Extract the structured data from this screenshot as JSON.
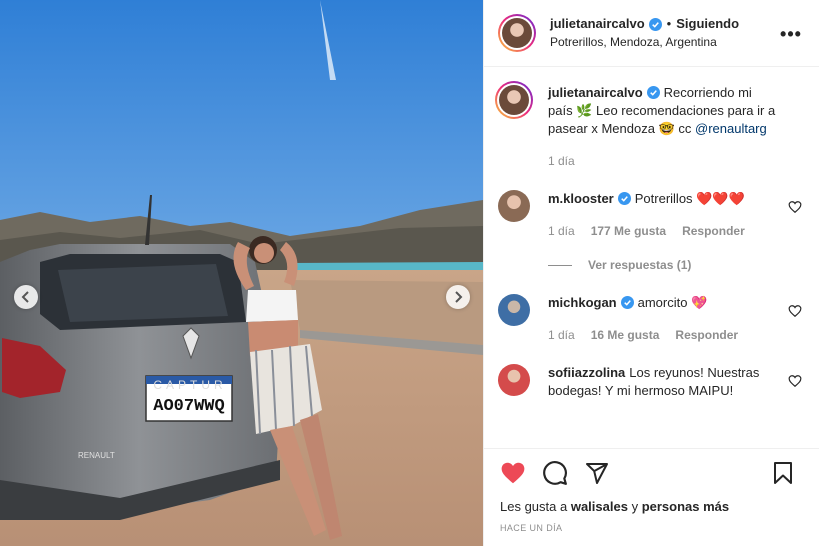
{
  "post": {
    "author": "julietanaircalvo",
    "follow_dot": "•",
    "follow_label": "Siguiendo",
    "location": "Potrerillos, Mendoza, Argentina",
    "more_label": "•••"
  },
  "photo": {
    "brand": "CAPTUR",
    "plate": "AO07WWQ",
    "car_badge": "RENAULT"
  },
  "caption": {
    "username": "julietanaircalvo",
    "text": "Recorriendo mi país 🌿 Leo recomendaciones para ir a pasear x Mendoza 🤓 cc",
    "mention": "@renaultarg",
    "time": "1 día"
  },
  "comments": [
    {
      "username": "m.klooster",
      "text": "Potrerillos ❤️❤️❤️",
      "time": "1 día",
      "likes": "177 Me gusta",
      "reply": "Responder",
      "view_replies": "Ver respuestas (1)"
    },
    {
      "username": "michkogan",
      "text": "amorcito 💖",
      "time": "1 día",
      "likes": "16 Me gusta",
      "reply": "Responder"
    },
    {
      "username": "sofiiazzolina",
      "text": "Los reyunos! Nuestras bodegas! Y mi hermoso MAIPU!"
    }
  ],
  "footer": {
    "likes_prefix": "Les gusta a",
    "likes_user": "walisales",
    "likes_and": "y",
    "likes_more": "personas más",
    "timestamp": "Hace un día"
  },
  "colors": {
    "liked_heart": "#ed4956",
    "verified": "#3897f0",
    "link": "#00376b",
    "muted": "#8e8e8e"
  },
  "icons": {
    "like": "heart-icon",
    "comment": "comment-icon",
    "share": "send-icon",
    "save": "bookmark-icon"
  }
}
